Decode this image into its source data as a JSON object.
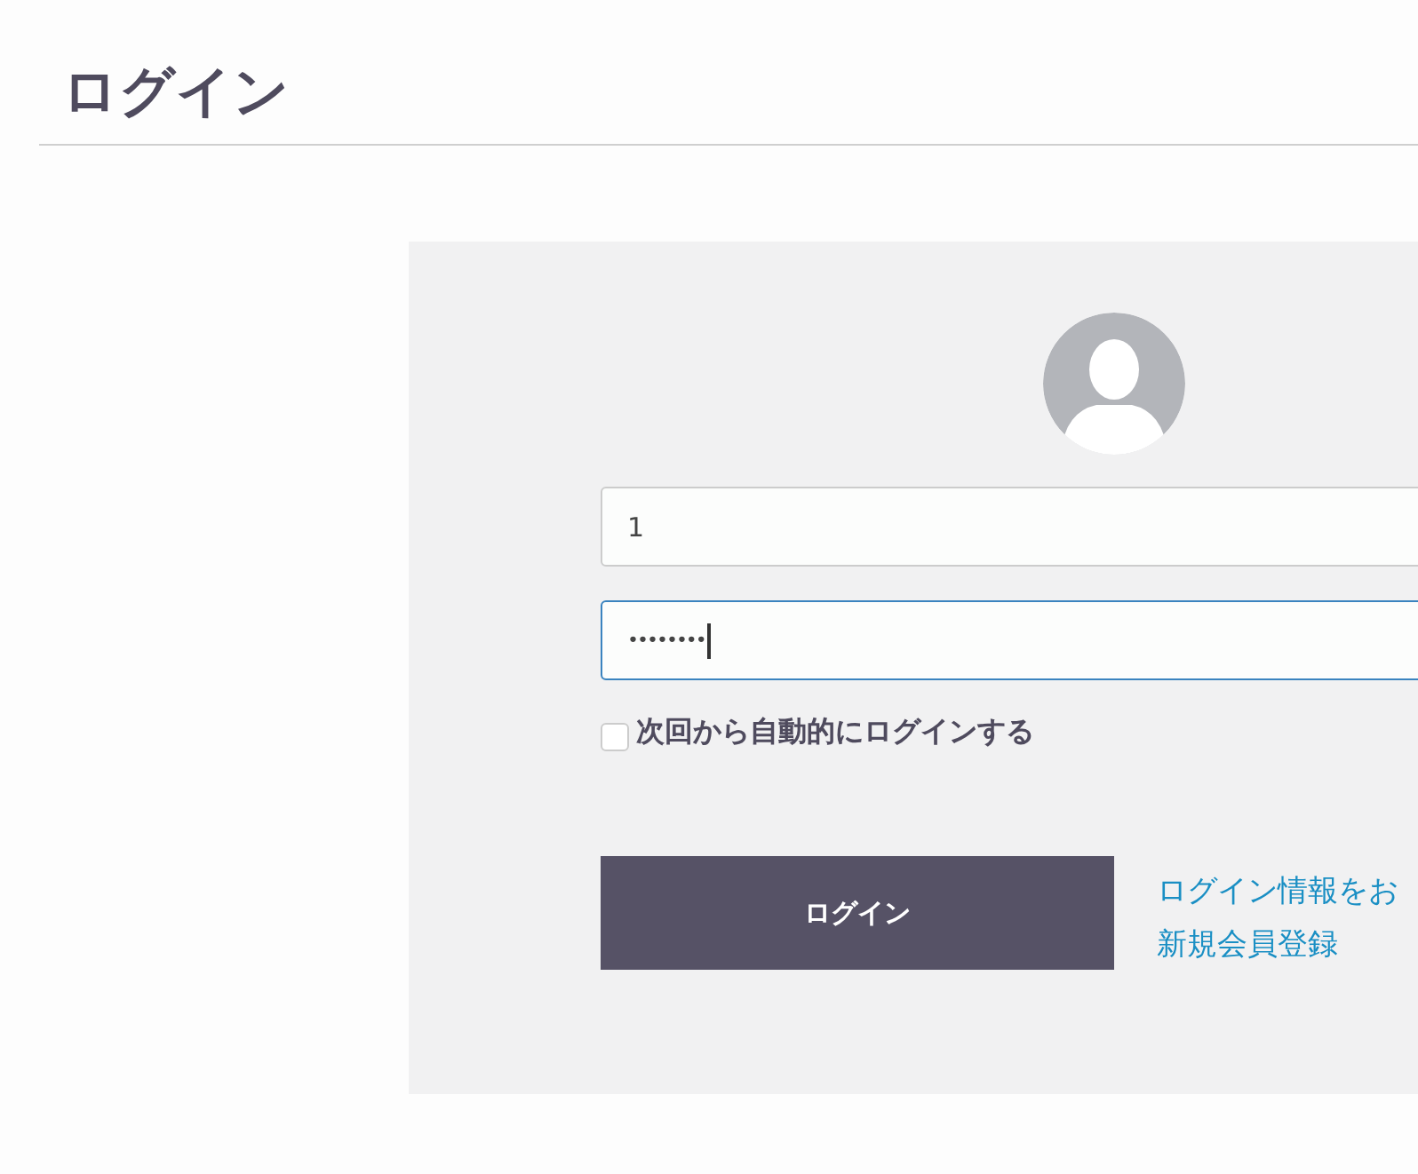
{
  "page_title": "ログイン",
  "login_form": {
    "username": {
      "value": "1",
      "focused": false
    },
    "password": {
      "value": "••••••••",
      "focused": true
    },
    "remember": {
      "label": "次回から自動的にログインする",
      "checked": false
    },
    "submit": "ログイン",
    "links": [
      "ログイン情報をお",
      "新規会員登録"
    ]
  }
}
